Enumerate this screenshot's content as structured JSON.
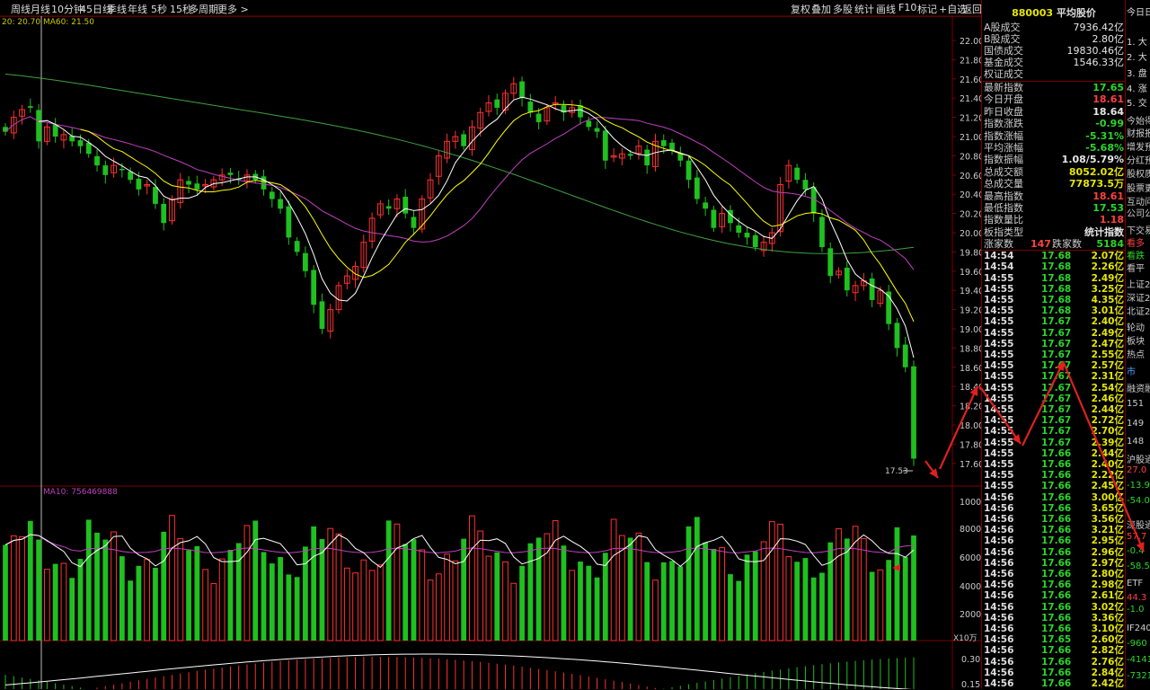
{
  "toolbar": {
    "left_items": [
      "周线",
      "月线",
      "10分钟",
      "45日线",
      "季线",
      "年线",
      "5秒",
      "15秒",
      "多周期",
      "更多 >"
    ],
    "right_items": [
      "复权",
      "叠加",
      "多股",
      "统计",
      "画线",
      "F10",
      "标记",
      "+自选",
      "返回"
    ]
  },
  "ma_legend": {
    "top_left": "20: 20.70  MA60: 21.50",
    "volume": "MA10: 756469888"
  },
  "price_axis": [
    "22.00",
    "21.80",
    "21.60",
    "21.40",
    "21.20",
    "21.00",
    "20.80",
    "20.60",
    "20.40",
    "20.20",
    "20.00",
    "19.80",
    "19.60",
    "19.40",
    "19.20",
    "19.00",
    "18.80",
    "18.60",
    "18.40",
    "18.20",
    "18.00",
    "17.80",
    "17.60"
  ],
  "volume_axis": [
    "10000",
    "8000",
    "6000",
    "4000",
    "2000"
  ],
  "volume_unit": "X10万",
  "indicator_axis": [
    "0.30",
    "0.15"
  ],
  "last_price_marker": "17.53",
  "index_panel": {
    "code": "880003",
    "name": "平均股价",
    "turnover": [
      {
        "label": "A股成交",
        "value": "7936.42亿"
      },
      {
        "label": "B股成交",
        "value": "2.80亿"
      },
      {
        "label": "国债成交",
        "value": "19830.46亿"
      },
      {
        "label": "基金成交",
        "value": "1546.33亿"
      },
      {
        "label": "权证成交",
        "value": ""
      }
    ],
    "stats": [
      {
        "label": "最新指数",
        "value": "17.65",
        "color": "#2bd62b"
      },
      {
        "label": "今日开盘",
        "value": "18.61",
        "color": "#ff4040"
      },
      {
        "label": "昨日收盘",
        "value": "18.64",
        "color": "#e6e6e6"
      },
      {
        "label": "指数涨跌",
        "value": "-0.99",
        "color": "#2bd62b"
      },
      {
        "label": "指数涨幅",
        "value": "-5.31%",
        "color": "#2bd62b"
      },
      {
        "label": "平均涨幅",
        "value": "-5.68%",
        "color": "#2bd62b"
      },
      {
        "label": "指数振幅",
        "value": "1.08/5.79%",
        "color": "#e6e6e6"
      },
      {
        "label": "总成交额",
        "value": "8052.02亿",
        "color": "#e6e600"
      },
      {
        "label": "总成交量",
        "value": "77873.5万",
        "color": "#e6e600"
      },
      {
        "label": "最高指数",
        "value": "18.61",
        "color": "#ff4040"
      },
      {
        "label": "最低指数",
        "value": "17.53",
        "color": "#2bd62b"
      },
      {
        "label": "指数量比",
        "value": "1.18",
        "color": "#ff4040"
      },
      {
        "label": "板指类型",
        "value": "统计指数",
        "color": "#e6e6e6"
      }
    ],
    "breadth": {
      "up_label": "涨家数",
      "up": "147",
      "down_label": "跌家数",
      "down": "5184"
    },
    "ticks": [
      [
        "14:54",
        "17.68",
        "2.07亿"
      ],
      [
        "14:54",
        "17.68",
        "2.26亿"
      ],
      [
        "14:55",
        "17.68",
        "2.49亿"
      ],
      [
        "14:55",
        "17.68",
        "3.25亿"
      ],
      [
        "14:55",
        "17.68",
        "4.35亿"
      ],
      [
        "14:55",
        "17.68",
        "3.01亿"
      ],
      [
        "14:55",
        "17.67",
        "2.40亿"
      ],
      [
        "14:55",
        "17.67",
        "2.49亿"
      ],
      [
        "14:55",
        "17.67",
        "2.47亿"
      ],
      [
        "14:55",
        "17.67",
        "2.55亿"
      ],
      [
        "14:55",
        "17.67",
        "2.57亿"
      ],
      [
        "14:55",
        "17.67",
        "2.31亿"
      ],
      [
        "14:55",
        "17.67",
        "2.54亿"
      ],
      [
        "14:55",
        "17.67",
        "2.46亿"
      ],
      [
        "14:55",
        "17.67",
        "2.44亿"
      ],
      [
        "14:55",
        "17.67",
        "2.72亿"
      ],
      [
        "14:55",
        "17.67",
        "2.70亿"
      ],
      [
        "14:55",
        "17.67",
        "2.39亿"
      ],
      [
        "14:55",
        "17.66",
        "2.44亿"
      ],
      [
        "14:55",
        "17.66",
        "2.40亿"
      ],
      [
        "14:55",
        "17.66",
        "2.22亿"
      ],
      [
        "14:55",
        "17.66",
        "2.45亿"
      ],
      [
        "14:56",
        "17.66",
        "3.00亿"
      ],
      [
        "14:56",
        "17.66",
        "3.65亿"
      ],
      [
        "14:56",
        "17.66",
        "3.56亿"
      ],
      [
        "14:56",
        "17.66",
        "3.21亿"
      ],
      [
        "14:56",
        "17.66",
        "2.95亿"
      ],
      [
        "14:56",
        "17.66",
        "2.96亿"
      ],
      [
        "14:56",
        "17.66",
        "2.97亿"
      ],
      [
        "14:56",
        "17.66",
        "2.80亿"
      ],
      [
        "14:56",
        "17.66",
        "2.98亿"
      ],
      [
        "14:56",
        "17.66",
        "2.61亿"
      ],
      [
        "14:56",
        "17.66",
        "3.02亿"
      ],
      [
        "14:56",
        "17.66",
        "3.36亿"
      ],
      [
        "14:56",
        "17.66",
        "3.10亿"
      ],
      [
        "14:56",
        "17.65",
        "2.60亿"
      ],
      [
        "14:56",
        "17.66",
        "2.82亿"
      ],
      [
        "14:56",
        "17.66",
        "2.76亿"
      ],
      [
        "14:56",
        "17.66",
        "2.84亿"
      ],
      [
        "14:56",
        "17.66",
        "2.42亿"
      ]
    ]
  },
  "side_panel": {
    "items": [
      {
        "text": "今日日",
        "color": "#ddd"
      },
      {
        "text": "1. 大",
        "color": "#ddd"
      },
      {
        "text": "2. 大",
        "color": "#ddd"
      },
      {
        "text": "3. 盘",
        "color": "#ddd"
      },
      {
        "text": "4. 涨",
        "color": "#ddd"
      },
      {
        "text": "5. 交",
        "color": "#ddd"
      },
      {
        "text": "今始得",
        "color": "#ccc"
      },
      {
        "text": "财报报",
        "color": "#ccc"
      },
      {
        "text": "增发预",
        "color": "#ccc"
      },
      {
        "text": "分红预",
        "color": "#ccc"
      },
      {
        "text": "股权质",
        "color": "#ccc"
      },
      {
        "text": "股票更",
        "color": "#ccc"
      },
      {
        "text": "互动问",
        "color": "#ccc"
      },
      {
        "text": "公司公",
        "color": "#ccc"
      },
      {
        "text": "下交易",
        "color": "#ccc"
      },
      {
        "text": "看多",
        "color": "#ff4040"
      },
      {
        "text": "看跌",
        "color": "#2bd62b"
      },
      {
        "text": "看平",
        "color": "#ccc"
      },
      {
        "text": "上证2",
        "color": "#ccc"
      },
      {
        "text": "深证2",
        "color": "#ccc"
      },
      {
        "text": "北证2",
        "color": "#ccc"
      },
      {
        "text": "轮动",
        "color": "#ccc"
      },
      {
        "text": "板块",
        "color": "#ccc"
      },
      {
        "text": "热点",
        "color": "#ccc"
      },
      {
        "text": "市",
        "color": "#4aa0ff"
      },
      {
        "text": "融资融",
        "color": "#ccc"
      },
      {
        "text": "151",
        "color": "#ccc"
      },
      {
        "text": "149",
        "color": "#ccc"
      },
      {
        "text": "148",
        "color": "#ccc"
      },
      {
        "text": "沪股通",
        "color": "#ccc"
      },
      {
        "text": "27.0",
        "color": "#ff4040"
      },
      {
        "text": "-13.9",
        "color": "#2bd62b"
      },
      {
        "text": "-54.0",
        "color": "#2bd62b"
      },
      {
        "text": "深股通",
        "color": "#ccc"
      },
      {
        "text": "57.7",
        "color": "#ff4040"
      },
      {
        "text": "-0.4",
        "color": "#2bd62b"
      },
      {
        "text": "-58.5",
        "color": "#2bd62b"
      },
      {
        "text": "ETF",
        "color": "#ccc"
      },
      {
        "text": "44.3",
        "color": "#ff4040"
      },
      {
        "text": "-1.0",
        "color": "#2bd62b"
      },
      {
        "text": "IF2402",
        "color": "#ccc"
      },
      {
        "text": "-960",
        "color": "#2bd62b"
      },
      {
        "text": "-4141",
        "color": "#2bd62b"
      },
      {
        "text": "-7321",
        "color": "#2bd62b"
      },
      {
        "text": "IC2402",
        "color": "#ccc"
      },
      {
        "text": "1906",
        "color": "#ccc"
      },
      {
        "text": "398",
        "color": "#ccc"
      }
    ]
  },
  "colors": {
    "up": "#ff3030",
    "down": "#1fc01f",
    "ma5": "#ffffff",
    "ma10": "#ffff00",
    "ma20": "#c040c0",
    "ma60": "#40a040",
    "grid": "#7a0000",
    "arrow": "#e02020"
  }
}
